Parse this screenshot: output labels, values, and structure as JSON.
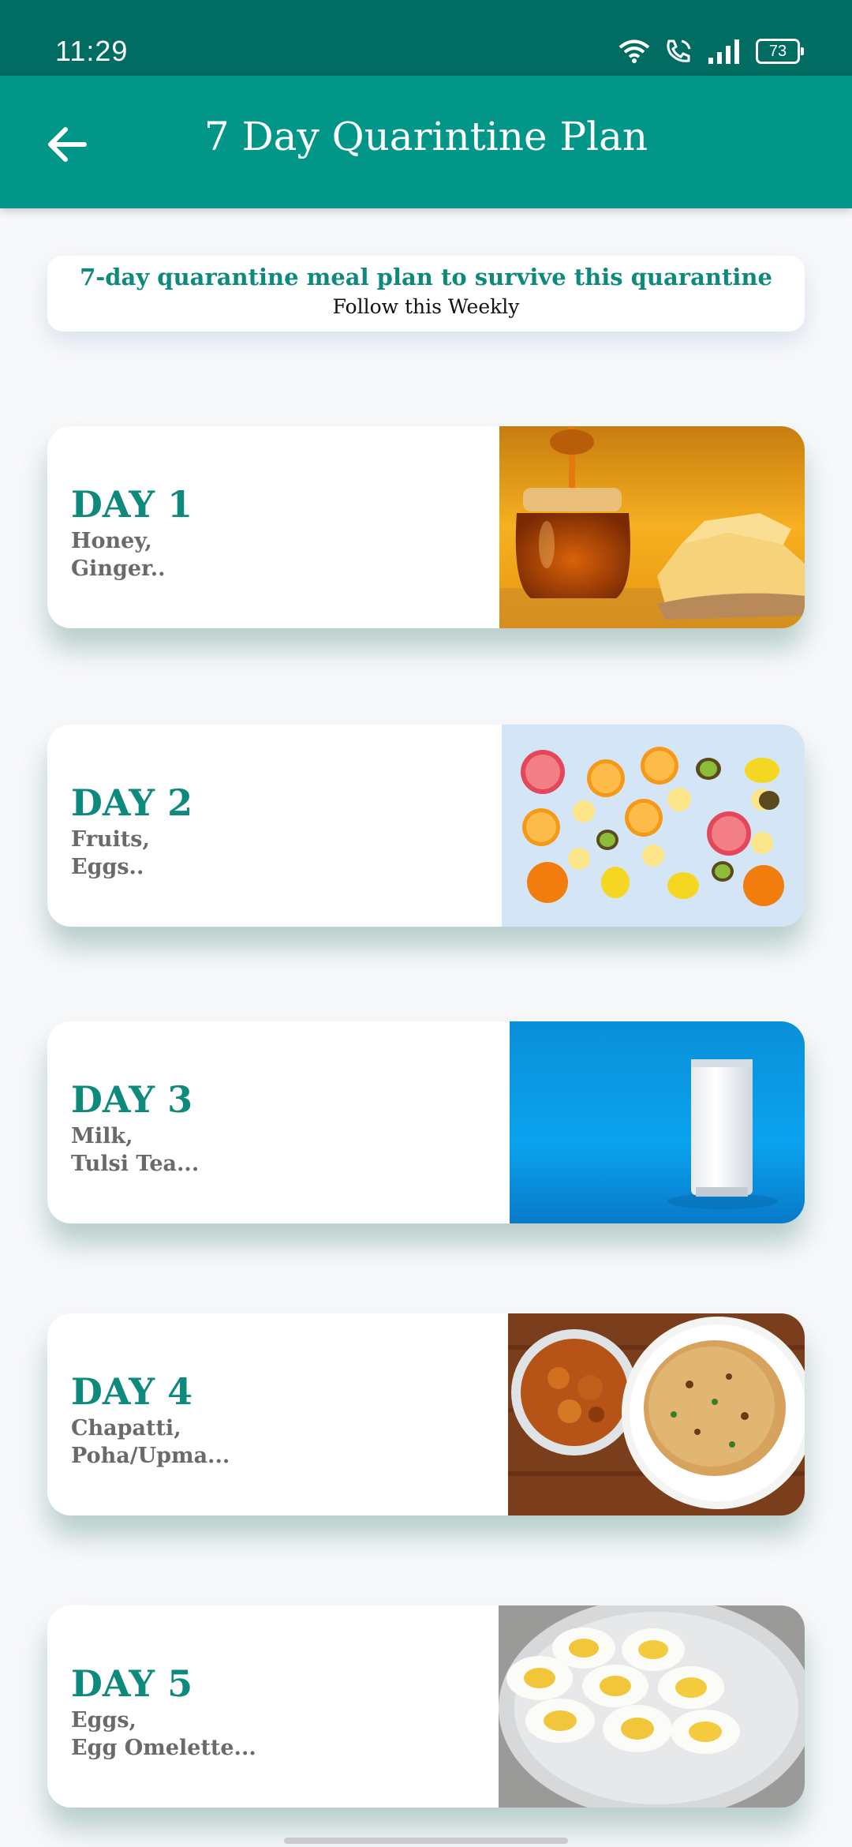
{
  "status_bar": {
    "time": "11:29",
    "battery": "73"
  },
  "app_bar": {
    "title": "7 Day Quarintine Plan",
    "back_icon": "arrow-left-icon"
  },
  "intro": {
    "headline": "7-day quarantine meal plan to survive this quarantine",
    "subtitle": "Follow this Weekly"
  },
  "days": [
    {
      "label": "DAY 1",
      "item1": "Honey,",
      "item2": "Ginger..",
      "image": "honey-jar-image"
    },
    {
      "label": "DAY 2",
      "item1": "Fruits,",
      "item2": "Eggs..",
      "image": "citrus-fruits-image"
    },
    {
      "label": "DAY 3",
      "item1": "Milk,",
      "item2": "Tulsi Tea...",
      "image": "milk-glass-image"
    },
    {
      "label": "DAY 4",
      "item1": "Chapatti,",
      "item2": "Poha/Upma...",
      "image": "curry-chapati-image"
    },
    {
      "label": "DAY 5",
      "item1": "Eggs,",
      "item2": "Egg Omelette...",
      "image": "boiled-eggs-image"
    }
  ],
  "colors": {
    "status_bar": "#016c62",
    "app_bar": "#019688",
    "accent": "#0e8a7d"
  }
}
